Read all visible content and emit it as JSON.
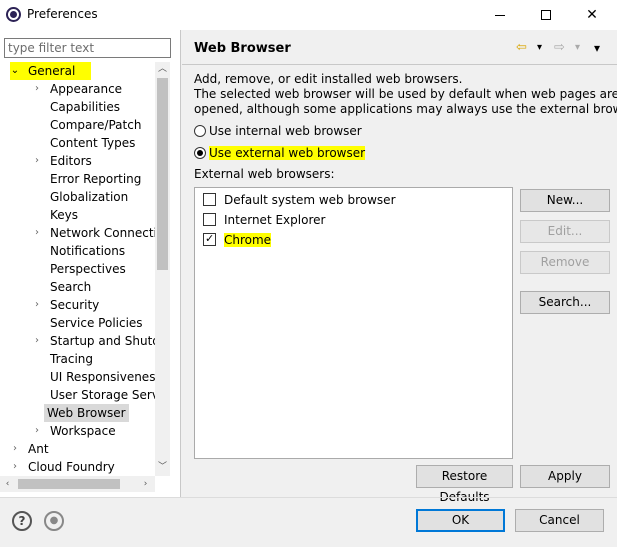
{
  "window": {
    "title": "Preferences"
  },
  "filter": {
    "placeholder": "type filter text"
  },
  "tree": [
    {
      "label": "General",
      "expanded": true,
      "level": 0,
      "highlight": true
    },
    {
      "label": "Appearance",
      "expandable": true,
      "level": 1
    },
    {
      "label": "Capabilities",
      "level": 1
    },
    {
      "label": "Compare/Patch",
      "level": 1
    },
    {
      "label": "Content Types",
      "level": 1
    },
    {
      "label": "Editors",
      "expandable": true,
      "level": 1
    },
    {
      "label": "Error Reporting",
      "level": 1
    },
    {
      "label": "Globalization",
      "level": 1
    },
    {
      "label": "Keys",
      "level": 1
    },
    {
      "label": "Network Connection",
      "expandable": true,
      "level": 1
    },
    {
      "label": "Notifications",
      "level": 1
    },
    {
      "label": "Perspectives",
      "level": 1
    },
    {
      "label": "Search",
      "level": 1
    },
    {
      "label": "Security",
      "expandable": true,
      "level": 1
    },
    {
      "label": "Service Policies",
      "level": 1
    },
    {
      "label": "Startup and Shutdo",
      "expandable": true,
      "level": 1
    },
    {
      "label": "Tracing",
      "level": 1
    },
    {
      "label": "UI Responsiveness M",
      "level": 1
    },
    {
      "label": "User Storage Service",
      "level": 1
    },
    {
      "label": "Web Browser",
      "level": 1,
      "selected": true
    },
    {
      "label": "Workspace",
      "expandable": true,
      "level": 1
    },
    {
      "label": "Ant",
      "expandable": true,
      "level": 0
    },
    {
      "label": "Cloud Foundry",
      "expandable": true,
      "level": 0
    }
  ],
  "page": {
    "title": "Web Browser",
    "description": [
      "Add, remove, or edit installed web browsers.",
      "The selected web browser will be used by default when web pages are",
      "opened, although some applications may always use the external browser."
    ],
    "radio_internal": "Use internal web browser",
    "radio_external": "Use external web browser",
    "external_label": "External web browsers:",
    "browsers": [
      {
        "label": "Default system web browser",
        "checked": false
      },
      {
        "label": "Internet Explorer",
        "checked": false
      },
      {
        "label": "Chrome",
        "checked": true
      }
    ]
  },
  "buttons": {
    "new": "New...",
    "edit": "Edit...",
    "remove": "Remove",
    "search": "Search...",
    "restore": "Restore Defaults",
    "apply": "Apply",
    "ok": "OK",
    "cancel": "Cancel"
  },
  "icons": {
    "back": "⇦",
    "forward": "⇨",
    "dropdown": "▾",
    "help": "?",
    "import": "●"
  },
  "colors": {
    "highlight": "#ffff00",
    "accent": "#0078d7"
  }
}
